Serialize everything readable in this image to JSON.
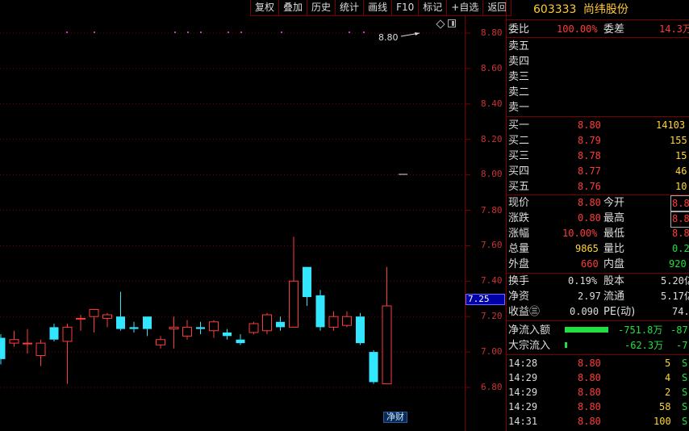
{
  "toolbar": {
    "buttons": [
      "复权",
      "叠加",
      "历史",
      "统计",
      "画线",
      "F10",
      "标记",
      "+自选",
      "返回"
    ]
  },
  "chart": {
    "y_ticks": [
      "8.80",
      "8.60",
      "8.40",
      "8.20",
      "8.00",
      "7.80",
      "7.60",
      "7.40",
      "7.20",
      "7.00",
      "6.80"
    ],
    "current_price_label": "7.25",
    "high_annotation": "8.80",
    "tag": "净财",
    "colors": {
      "up": "#ff3b3b",
      "down": "#33e6ff",
      "grid": "#7a0000"
    }
  },
  "chart_data": {
    "type": "candlestick",
    "ylim": [
      6.72,
      8.88
    ],
    "candles": [
      {
        "o": 7.08,
        "c": 6.96,
        "h": 7.1,
        "l": 6.93
      },
      {
        "o": 7.05,
        "c": 7.07,
        "h": 7.12,
        "l": 7.03
      },
      {
        "o": 7.05,
        "c": 7.05,
        "h": 7.13,
        "l": 6.99
      },
      {
        "o": 6.98,
        "c": 7.05,
        "h": 7.07,
        "l": 6.92
      },
      {
        "o": 7.14,
        "c": 7.07,
        "h": 7.16,
        "l": 7.06
      },
      {
        "o": 7.06,
        "c": 7.14,
        "h": 7.16,
        "l": 6.82
      },
      {
        "o": 7.19,
        "c": 7.19,
        "h": 7.21,
        "l": 7.12
      },
      {
        "o": 7.2,
        "c": 7.24,
        "h": 7.24,
        "l": 7.11
      },
      {
        "o": 7.19,
        "c": 7.21,
        "h": 7.22,
        "l": 7.14
      },
      {
        "o": 7.2,
        "c": 7.13,
        "h": 7.34,
        "l": 7.12
      },
      {
        "o": 7.14,
        "c": 7.13,
        "h": 7.17,
        "l": 7.11
      },
      {
        "o": 7.2,
        "c": 7.13,
        "h": 7.2,
        "l": 7.09
      },
      {
        "o": 7.04,
        "c": 7.07,
        "h": 7.09,
        "l": 7.02
      },
      {
        "o": 7.13,
        "c": 7.14,
        "h": 7.2,
        "l": 7.02
      },
      {
        "o": 7.09,
        "c": 7.14,
        "h": 7.18,
        "l": 7.07
      },
      {
        "o": 7.14,
        "c": 7.13,
        "h": 7.17,
        "l": 7.1
      },
      {
        "o": 7.12,
        "c": 7.17,
        "h": 7.18,
        "l": 7.08
      },
      {
        "o": 7.11,
        "c": 7.09,
        "h": 7.13,
        "l": 7.07
      },
      {
        "o": 7.07,
        "c": 7.05,
        "h": 7.1,
        "l": 7.04
      },
      {
        "o": 7.11,
        "c": 7.16,
        "h": 7.17,
        "l": 7.1
      },
      {
        "o": 7.12,
        "c": 7.21,
        "h": 7.22,
        "l": 7.1
      },
      {
        "o": 7.17,
        "c": 7.14,
        "h": 7.2,
        "l": 7.12
      },
      {
        "o": 7.14,
        "c": 7.4,
        "h": 7.65,
        "l": 7.14
      },
      {
        "o": 7.48,
        "c": 7.31,
        "h": 7.48,
        "l": 7.26
      },
      {
        "o": 7.32,
        "c": 7.14,
        "h": 7.35,
        "l": 7.12
      },
      {
        "o": 7.14,
        "c": 7.2,
        "h": 7.23,
        "l": 7.12
      },
      {
        "o": 7.15,
        "c": 7.2,
        "h": 7.23,
        "l": 7.14
      },
      {
        "o": 7.2,
        "c": 7.05,
        "h": 7.22,
        "l": 7.04
      },
      {
        "o": 7.0,
        "c": 6.83,
        "h": 7.01,
        "l": 6.82
      },
      {
        "o": 6.82,
        "c": 7.26,
        "h": 7.48,
        "l": 6.82
      }
    ]
  },
  "panel": {
    "code": "603333",
    "name": "尚纬股份",
    "weibi_label": "委比",
    "weibi_value": "100.00%",
    "weicha_label": "委差",
    "weicha_value": "14.3万",
    "sell": [
      {
        "label": "卖五"
      },
      {
        "label": "卖四"
      },
      {
        "label": "卖三"
      },
      {
        "label": "卖二"
      },
      {
        "label": "卖一"
      }
    ],
    "buy": [
      {
        "label": "买一",
        "price": "8.80",
        "vol": "14103"
      },
      {
        "label": "买二",
        "price": "8.79",
        "vol": "155"
      },
      {
        "label": "买三",
        "price": "8.78",
        "vol": "15"
      },
      {
        "label": "买四",
        "price": "8.77",
        "vol": "46"
      },
      {
        "label": "买五",
        "price": "8.76",
        "vol": "10"
      }
    ],
    "quote": {
      "xianjia_label": "现价",
      "xianjia": "8.80",
      "jinkai_label": "今开",
      "jinkai": "8.8",
      "zhangdie_label": "涨跌",
      "zhangdie": "0.80",
      "zuigao_label": "最高",
      "zuigao": "8.8",
      "zhangfu_label": "涨幅",
      "zhangfu": "10.00%",
      "zuidi_label": "最低",
      "zuidi": "8.8",
      "zongliang_label": "总量",
      "zongliang": "9865",
      "liangbi_label": "量比",
      "liangbi": "0.2",
      "waipan_label": "外盘",
      "waipan": "660",
      "neipan_label": "内盘",
      "neipan": "920"
    },
    "fin": {
      "huanshou_label": "换手",
      "huanshou": "0.19%",
      "guben_label": "股本",
      "guben": "5.20亿",
      "jingzi_label": "净资",
      "jingzi": "2.97",
      "liutong_label": "流通",
      "liutong": "5.17亿",
      "shouyi_label": "收益㊂",
      "shouyi": "0.090",
      "pe_label": "PE(动)",
      "pe": "74."
    },
    "flow": {
      "net_label": "净流入额",
      "net_value": "-751.8万",
      "net_pct": "-87",
      "block_label": "大宗流入",
      "block_value": "-62.3万",
      "block_pct": "-7"
    },
    "ticks": [
      {
        "time": "14:28",
        "price": "8.80",
        "vol": "5",
        "flag": "S"
      },
      {
        "time": "14:29",
        "price": "8.80",
        "vol": "4",
        "flag": "S"
      },
      {
        "time": "14:29",
        "price": "8.80",
        "vol": "2",
        "flag": "S"
      },
      {
        "time": "14:29",
        "price": "8.80",
        "vol": "58",
        "flag": "S"
      },
      {
        "time": "14:31",
        "price": "8.80",
        "vol": "100",
        "flag": "S"
      }
    ]
  }
}
